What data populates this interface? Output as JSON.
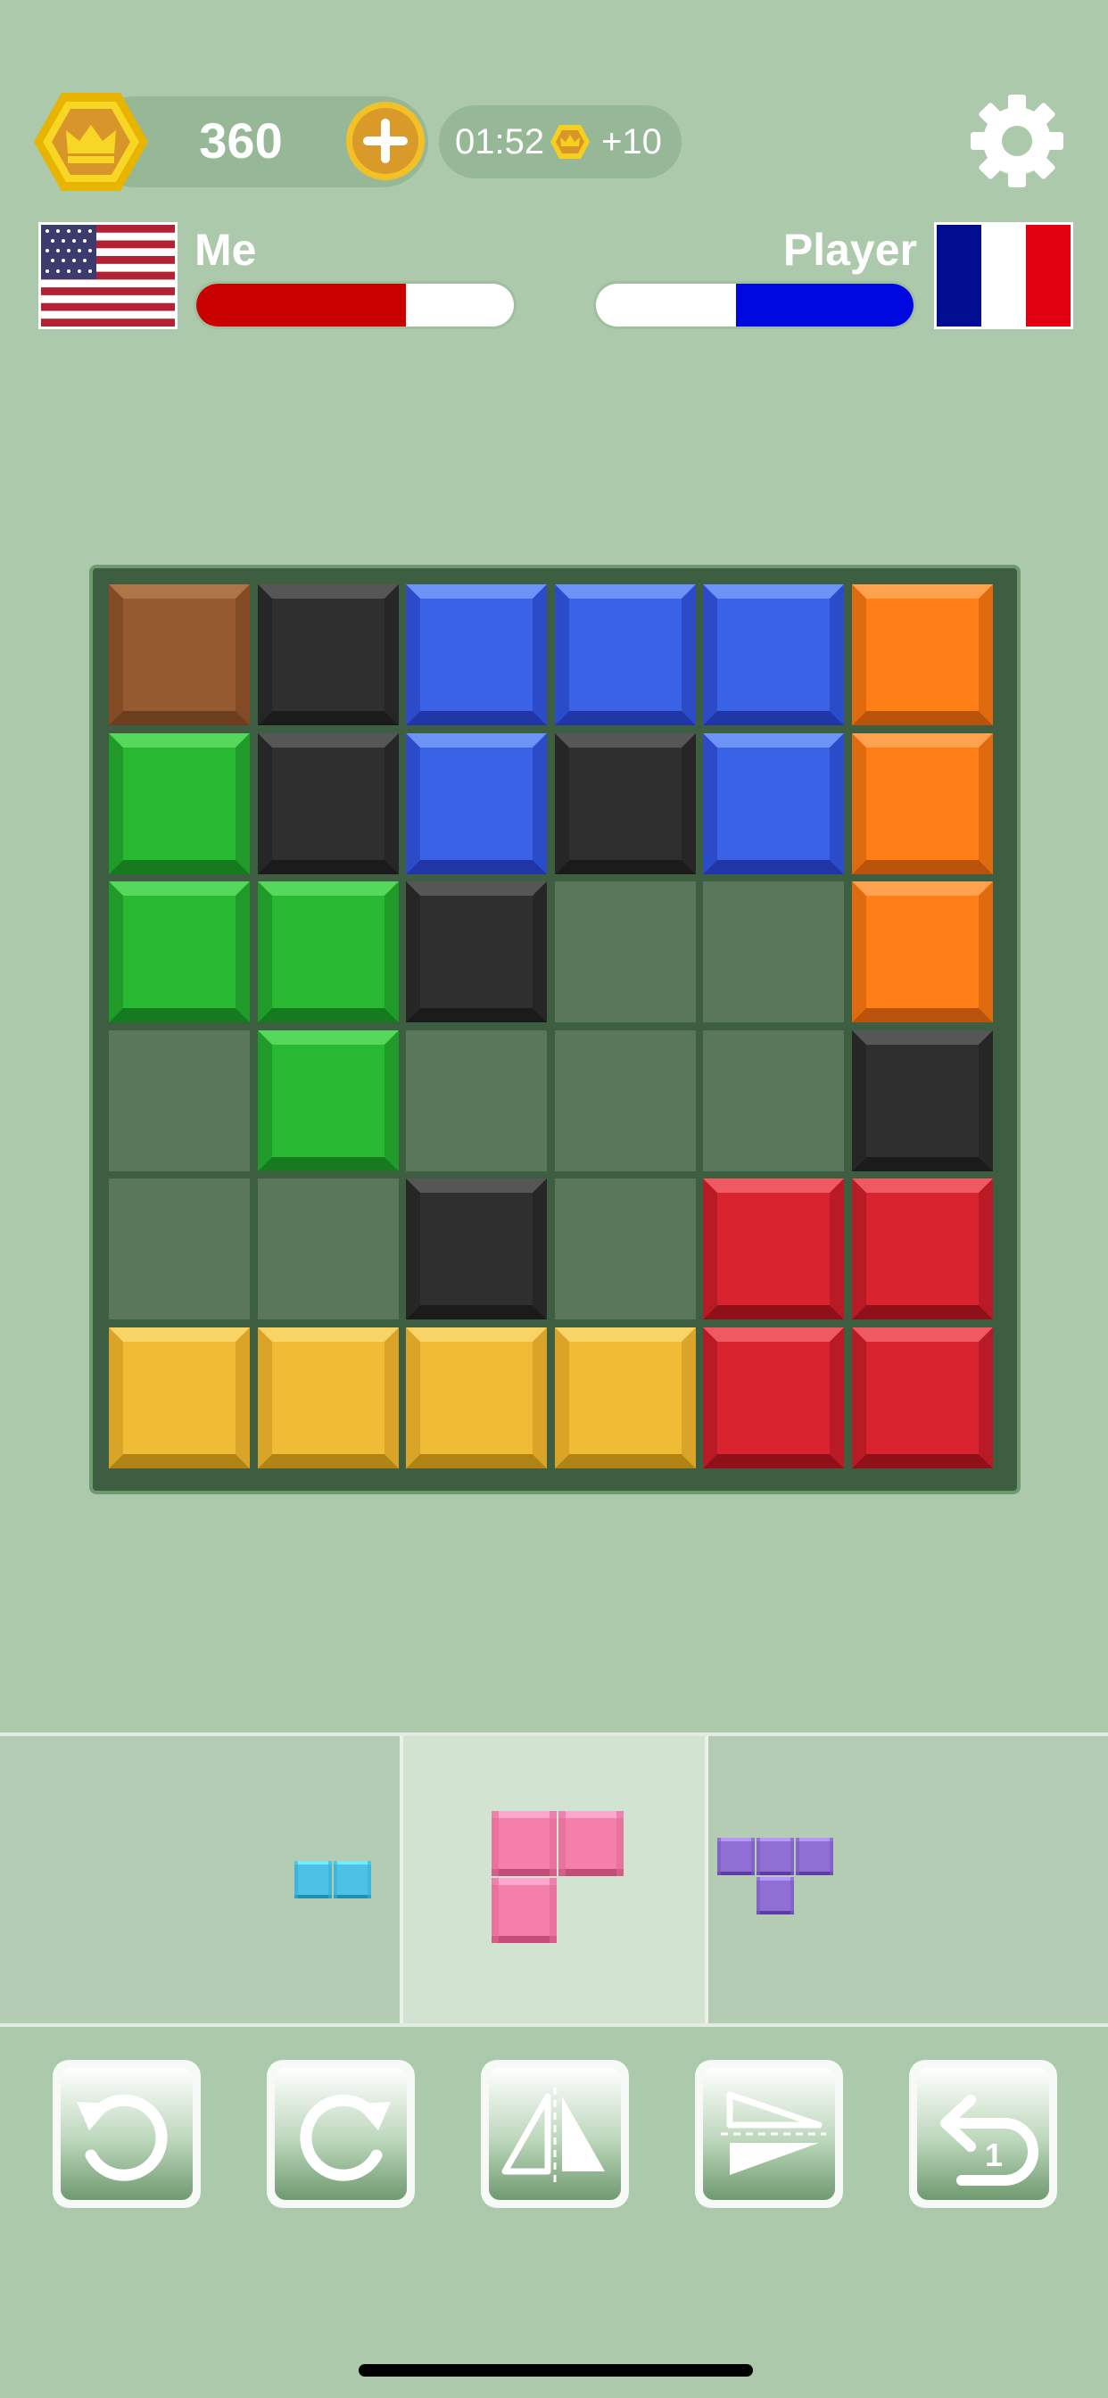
{
  "header": {
    "coins": "360",
    "timer": "01:52",
    "bonus": "+10",
    "coin_icon": "crown-coin-icon",
    "add_icon": "plus-icon",
    "settings_icon": "gear-icon"
  },
  "players": {
    "me": {
      "name": "Me",
      "flag": "usa-flag-icon",
      "progress": 0.66,
      "bar_color": "#c80000"
    },
    "opponent": {
      "name": "Player",
      "flag": "france-flag-icon",
      "progress": 0.56,
      "bar_color": "#0008e0"
    }
  },
  "board": {
    "rows": 6,
    "cols": 6,
    "cells": [
      [
        "brown",
        "black",
        "blue",
        "blue",
        "blue",
        "orange"
      ],
      [
        "green",
        "black",
        "blue",
        "black",
        "blue",
        "orange"
      ],
      [
        "green",
        "green",
        "black",
        "empty",
        "empty",
        "orange"
      ],
      [
        "empty",
        "green",
        "empty",
        "empty",
        "empty",
        "black"
      ],
      [
        "empty",
        "empty",
        "black",
        "empty",
        "red",
        "red"
      ],
      [
        "yellow",
        "yellow",
        "yellow",
        "yellow",
        "red",
        "red"
      ]
    ],
    "palette": {
      "brown": {
        "base": "#955a30",
        "light": "#ad7548",
        "dark": "#6c3d1f",
        "side": "#824b26"
      },
      "black": {
        "base": "#2f2f2f",
        "light": "#565656",
        "dark": "#1b1b1b",
        "side": "#262626"
      },
      "blue": {
        "base": "#3a62e6",
        "light": "#6e93f6",
        "dark": "#2036a6",
        "side": "#2c4bc8"
      },
      "orange": {
        "base": "#ff7e16",
        "light": "#ffa24f",
        "dark": "#b9520a",
        "side": "#e06a0e"
      },
      "green": {
        "base": "#29b832",
        "light": "#55d85c",
        "dark": "#167a1e",
        "side": "#209a28"
      },
      "red": {
        "base": "#d9232f",
        "light": "#ef5a62",
        "dark": "#8f1018",
        "side": "#b81b25"
      },
      "yellow": {
        "base": "#f0bc36",
        "light": "#f8d466",
        "dark": "#b18315",
        "side": "#d9a428"
      },
      "empty": {
        "base": "#5a765b"
      }
    }
  },
  "tray": {
    "pieces": [
      {
        "name": "cyan-domino-piece",
        "color": "#4cc3e4",
        "cells": [
          [
            0,
            0
          ],
          [
            1,
            0
          ]
        ]
      },
      {
        "name": "pink-l-tromino-piece",
        "color": "#f47fa9",
        "cells": [
          [
            0,
            0
          ],
          [
            1,
            0
          ],
          [
            0,
            1
          ]
        ]
      },
      {
        "name": "purple-t-tetromino-piece",
        "color": "#8f6fd3",
        "cells": [
          [
            0,
            0
          ],
          [
            1,
            0
          ],
          [
            2,
            0
          ],
          [
            1,
            1
          ]
        ]
      }
    ],
    "selected_index": 1
  },
  "controls": [
    {
      "name": "rotate-left-button",
      "icon": "rotate-left-icon"
    },
    {
      "name": "rotate-right-button",
      "icon": "rotate-right-icon"
    },
    {
      "name": "flip-horizontal-button",
      "icon": "flip-horizontal-icon"
    },
    {
      "name": "flip-vertical-button",
      "icon": "flip-vertical-icon"
    },
    {
      "name": "undo-button",
      "icon": "undo-icon",
      "count": "1"
    }
  ]
}
